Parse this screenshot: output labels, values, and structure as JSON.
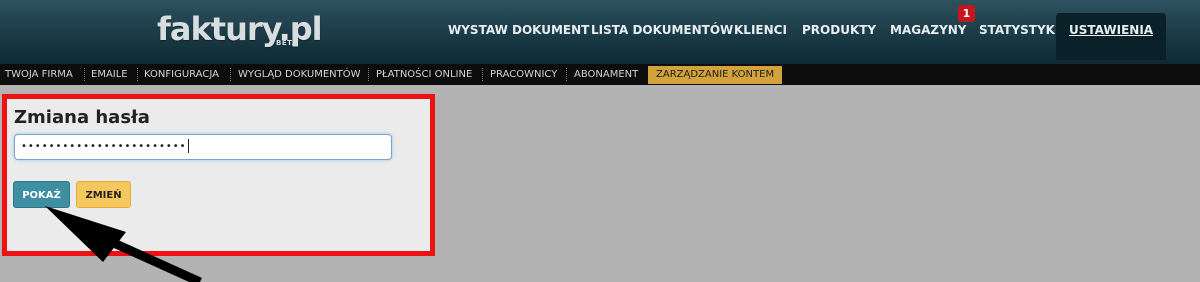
{
  "header": {
    "logo": "faktury.pl",
    "logo_badge": "BETA",
    "nav": [
      {
        "label": "WYSTAW DOKUMENT"
      },
      {
        "label": "LISTA DOKUMENTÓW"
      },
      {
        "label": "KLIENCI"
      },
      {
        "label": "PRODUKTY"
      },
      {
        "label": "MAGAZYNY"
      },
      {
        "label": "STATYSTYKI"
      },
      {
        "label": "USTAWIENIA"
      }
    ],
    "magazyny_badge": "1"
  },
  "subnav": {
    "items": [
      {
        "label": "TWOJA FIRMA"
      },
      {
        "label": "EMAILE"
      },
      {
        "label": "KONFIGURACJA"
      },
      {
        "label": "WYGLĄD DOKUMENTÓW"
      },
      {
        "label": "PŁATNOŚCI ONLINE"
      },
      {
        "label": "PRACOWNICY"
      },
      {
        "label": "ABONAMENT"
      },
      {
        "label": "ZARZĄDZANIE KONTEM"
      }
    ],
    "active": "ZARZĄDZANIE KONTEM"
  },
  "password_panel": {
    "title": "Zmiana hasła",
    "password_masked": "••••••••••••••••••••••••",
    "show_button": "POKAŻ",
    "change_button": "ZMIEŃ"
  },
  "colors": {
    "highlight_border": "#ee1111",
    "show_button": "#3f8fa3",
    "change_button": "#f6c75c",
    "active_subnav": "#d2a33a"
  }
}
